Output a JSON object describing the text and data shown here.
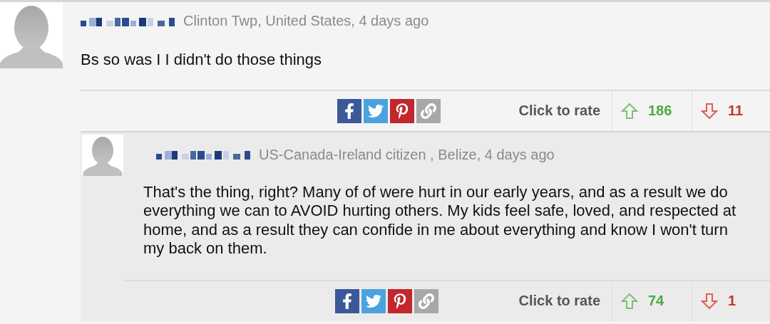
{
  "comments": [
    {
      "meta": "Clinton Twp, United States, 4 days ago",
      "body": "Bs so was I I didn't do those things",
      "rate_label": "Click to rate",
      "up": "186",
      "down": "11",
      "replies": [
        {
          "meta": "US-Canada-Ireland citizen , Belize, 4 days ago",
          "body": "That's the thing, right? Many of of were hurt in our early years, and as a result we do everything we can to AVOID hurting others. My kids feel safe, loved, and respected at home, and as a result they can confide in me about everything and know I won't turn my back on them.",
          "rate_label": "Click to rate",
          "up": "74",
          "down": "1"
        }
      ]
    }
  ]
}
